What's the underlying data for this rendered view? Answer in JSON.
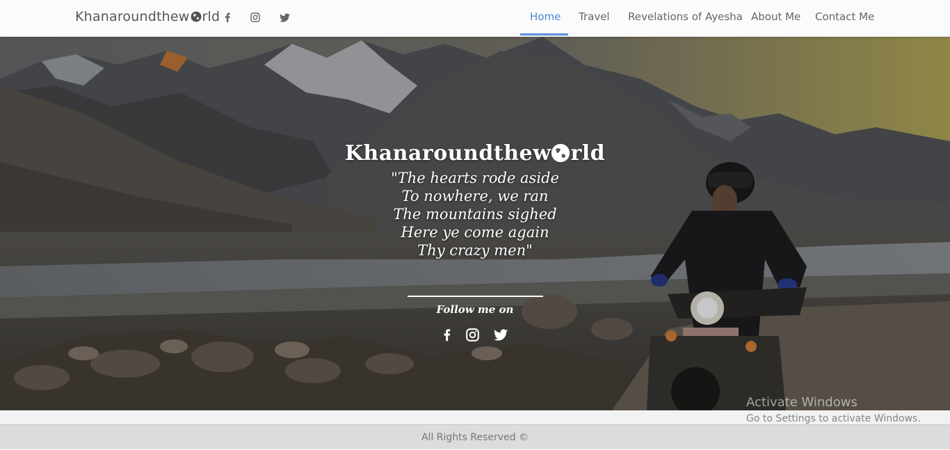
{
  "navbar": {
    "brand": "Khanaroundthew",
    "brand_suffix": "rld",
    "social": [
      "facebook-icon",
      "instagram-icon",
      "twitter-icon"
    ],
    "links": [
      {
        "label": "Home",
        "active": true
      },
      {
        "label": "Travel",
        "active": false
      },
      {
        "label": "Revelations of Ayesha",
        "active": false
      },
      {
        "label": "About Me",
        "active": false
      },
      {
        "label": "Contact Me",
        "active": false
      }
    ],
    "accent": "#4a86d6"
  },
  "hero": {
    "title": "Khanaroundthew",
    "title_suffix": "rld",
    "poem": [
      "\"The hearts rode aside",
      "To nowhere, we ran",
      "The mountains sighed",
      "Here ye come again",
      "Thy crazy men\""
    ],
    "follow_label": "Follow me on",
    "social": [
      "facebook-icon",
      "instagram-icon",
      "twitter-icon"
    ]
  },
  "watermark": {
    "line1": "Activate Windows",
    "line2": "Go to Settings to activate Windows."
  },
  "footer": {
    "text": "All Rights Reserved ©"
  }
}
